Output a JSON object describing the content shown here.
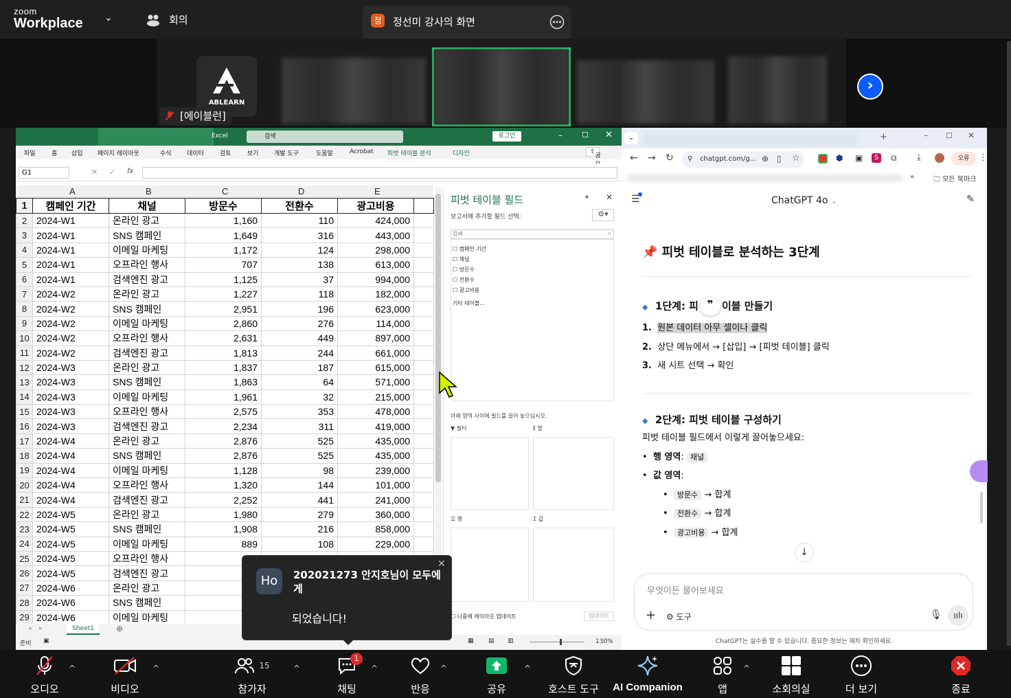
{
  "app": {
    "brand_top": "zoom",
    "brand_bottom": "Workplace",
    "meeting_label": "회의"
  },
  "share": {
    "badge": "정",
    "title": "정선미 강사의 화면"
  },
  "video": {
    "participant_name": "[에이블런]",
    "logo_text": "ABLEARN"
  },
  "excel": {
    "app_name": "Excel",
    "search_placeholder": "검색",
    "login": "로그인",
    "share_btn": "공유",
    "ribbon_tabs": [
      "파일",
      "홈",
      "삽입",
      "페이지 레이아웃",
      "수식",
      "데이터",
      "검토",
      "보기",
      "개발 도구",
      "도움말",
      "Acrobat",
      "피벗 테이블 분석",
      "디자인"
    ],
    "name_box": "G1",
    "fx": "fx",
    "col_letters": [
      "A",
      "B",
      "C",
      "D",
      "E"
    ],
    "headers": [
      "캠페인 기간",
      "채널",
      "방문수",
      "전환수",
      "광고비용"
    ],
    "rows": [
      [
        "2024-W1",
        "온라인 광고",
        "1,160",
        "110",
        "424,000"
      ],
      [
        "2024-W1",
        "SNS 캠페인",
        "1,649",
        "316",
        "443,000"
      ],
      [
        "2024-W1",
        "이메일 마케팅",
        "1,172",
        "124",
        "298,000"
      ],
      [
        "2024-W1",
        "오프라인 행사",
        "707",
        "138",
        "613,000"
      ],
      [
        "2024-W1",
        "검색엔진 광고",
        "1,125",
        "37",
        "994,000"
      ],
      [
        "2024-W2",
        "온라인 광고",
        "1,227",
        "118",
        "182,000"
      ],
      [
        "2024-W2",
        "SNS 캠페인",
        "2,951",
        "196",
        "623,000"
      ],
      [
        "2024-W2",
        "이메일 마케팅",
        "2,860",
        "276",
        "114,000"
      ],
      [
        "2024-W2",
        "오프라인 행사",
        "2,631",
        "449",
        "897,000"
      ],
      [
        "2024-W2",
        "검색엔진 광고",
        "1,813",
        "244",
        "661,000"
      ],
      [
        "2024-W3",
        "온라인 광고",
        "1,837",
        "187",
        "615,000"
      ],
      [
        "2024-W3",
        "SNS 캠페인",
        "1,863",
        "64",
        "571,000"
      ],
      [
        "2024-W3",
        "이메일 마케팅",
        "1,961",
        "32",
        "215,000"
      ],
      [
        "2024-W3",
        "오프라인 행사",
        "2,575",
        "353",
        "478,000"
      ],
      [
        "2024-W3",
        "검색엔진 광고",
        "2,234",
        "311",
        "419,000"
      ],
      [
        "2024-W4",
        "온라인 광고",
        "2,876",
        "525",
        "435,000"
      ],
      [
        "2024-W4",
        "SNS 캠페인",
        "2,876",
        "525",
        "435,000"
      ],
      [
        "2024-W4",
        "이메일 마케팅",
        "1,128",
        "98",
        "239,000"
      ],
      [
        "2024-W4",
        "오프라인 행사",
        "1,320",
        "144",
        "101,000"
      ],
      [
        "2024-W4",
        "검색엔진 광고",
        "2,252",
        "441",
        "241,000"
      ],
      [
        "2024-W5",
        "온라인 광고",
        "1,980",
        "279",
        "360,000"
      ],
      [
        "2024-W5",
        "SNS 캠페인",
        "1,908",
        "216",
        "858,000"
      ],
      [
        "2024-W5",
        "이메일 마케팅",
        "889",
        "108",
        "229,000"
      ],
      [
        "2024-W5",
        "오프라인 행사",
        "2,",
        "",
        ""
      ],
      [
        "2024-W5",
        "검색엔진 광고",
        "2,",
        "",
        ""
      ],
      [
        "2024-W6",
        "온라인 광고",
        "1,",
        "",
        ""
      ],
      [
        "2024-W6",
        "SNS 캠페인",
        "2,",
        "",
        ""
      ],
      [
        "2024-W6",
        "이메일 마케팅",
        "2,",
        "",
        ""
      ]
    ],
    "sheet_tab": "Sheet1",
    "status": "준비",
    "zoom_pct": "130%",
    "pivot": {
      "title": "피벗 테이블 필드",
      "subtitle": "보고서에 추가할 필드 선택:",
      "search": "검색",
      "fields": [
        "캠페인 기간",
        "채널",
        "방문수",
        "전환수",
        "광고비용"
      ],
      "more": "기타 테이블...",
      "drag_hint": "아래 영역 사이에 필드를 끌어 놓으십시오.",
      "areas": [
        "필터",
        "열",
        "행",
        "값"
      ],
      "defer": "나중에 레이아웃 업데이트",
      "update": "업데이트"
    }
  },
  "chrome": {
    "url": "chatgpt.com/g...",
    "bookmarks": "모든 북마크",
    "profile_btn": "오류",
    "gpt_title": "ChatGPT 4o",
    "h_main": "피벗 테이블로 분석하는 3단계",
    "step1_title_a": "1단계: 피",
    "step1_title_b": "이블 만들기",
    "step1_items": [
      "원본 데이터 아무 셀이나 클릭",
      "상단 메뉴에서 → [삽입] → [피벗 테이블] 클릭",
      "새 시트 선택 → 확인"
    ],
    "step2_title": "2단계: 피벗 테이블 구성하기",
    "step2_intro": "피벗 테이블 필드에서 이렇게 끌어놓으세요:",
    "row_area": "행 영역",
    "row_val": "채널",
    "val_area": "값 영역",
    "val_items": [
      [
        "방문수",
        "→ 합계"
      ],
      [
        "전환수",
        "→ 합계"
      ],
      [
        "광고비용",
        "→ 합계"
      ]
    ],
    "input_placeholder": "무엇이든 물어보세요",
    "tools": "도구",
    "disclaimer": "ChatGPT는 실수를 할 수 있습니다. 중요한 정보는 재차 확인하세요."
  },
  "toast": {
    "avatar": "Ho",
    "title": "202021273 안지호님이 모두에게",
    "message": "되었습니다!"
  },
  "toolbar": {
    "audio": "오디오",
    "video": "비디오",
    "participants": "참가자",
    "participants_count": "15",
    "chat": "채팅",
    "chat_badge": "1",
    "reactions": "반응",
    "share": "공유",
    "host_tools": "호스트 도구",
    "ai": "AI Companion",
    "apps": "앱",
    "breakout": "소회의실",
    "more": "더 보기",
    "end": "종료"
  },
  "colors": {
    "excel_green": "#1e7145",
    "share_green": "#12b76a",
    "zoom_blue": "#0b5cff",
    "end_red": "#e02828"
  }
}
